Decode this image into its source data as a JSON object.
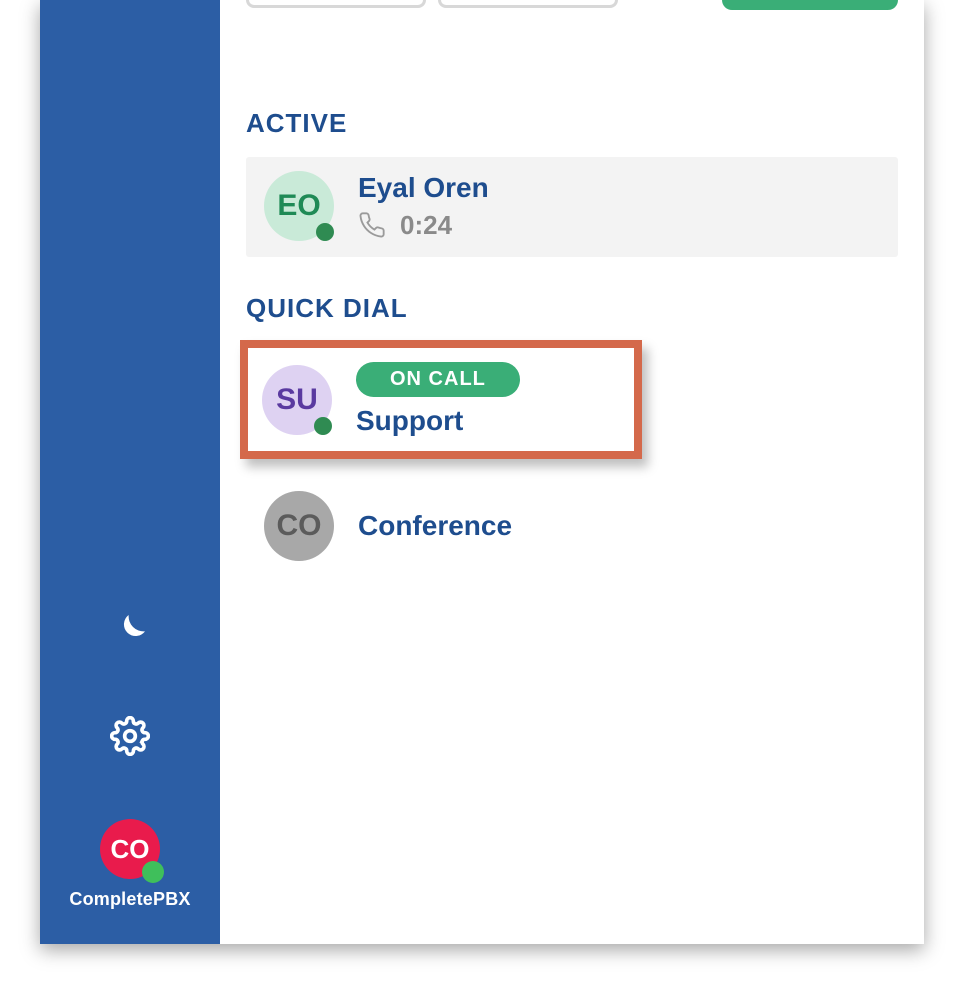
{
  "sidebar": {
    "user": {
      "initials": "CO",
      "label": "CompletePBX"
    }
  },
  "sections": {
    "active_label": "ACTIVE",
    "quickdial_label": "QUICK DIAL"
  },
  "active_call": {
    "avatar_initials": "EO",
    "name": "Eyal Oren",
    "timer": "0:24"
  },
  "quick_dial": [
    {
      "avatar_initials": "SU",
      "status": "ON CALL",
      "name": "Support",
      "highlighted": true
    },
    {
      "avatar_initials": "CO",
      "name": "Conference"
    }
  ]
}
